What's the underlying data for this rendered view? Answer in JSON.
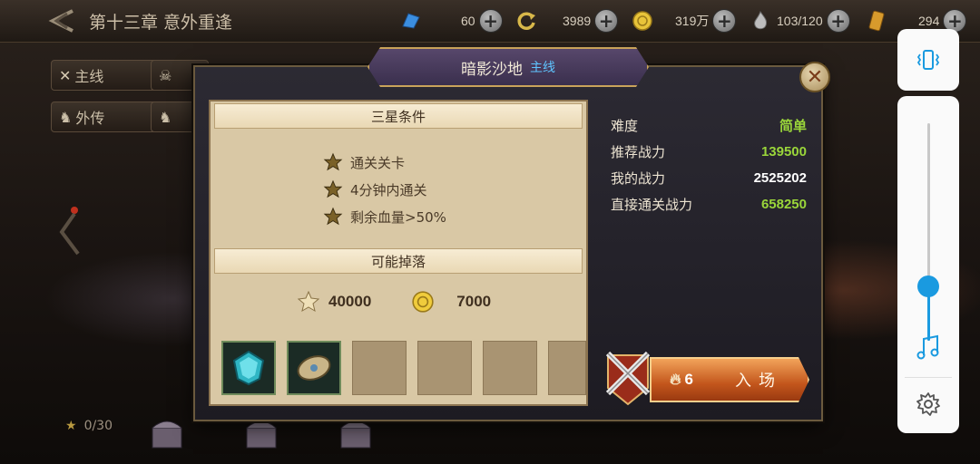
{
  "header": {
    "chapter_title": "第十三章 意外重逢",
    "resources": [
      {
        "name": "crystal",
        "value": "60",
        "icon": "crystal-icon",
        "color": "#3b8ee0"
      },
      {
        "name": "refresh",
        "value": "3989",
        "icon": "refresh-icon",
        "color": "#d8b84a"
      },
      {
        "name": "gold",
        "value": "319万",
        "icon": "gold-coin-icon",
        "color": "#e8c43a"
      },
      {
        "name": "stamina",
        "value": "103/120",
        "icon": "flame-icon",
        "color": "#bdbdbd"
      },
      {
        "name": "ticket",
        "value": "294",
        "icon": "ticket-icon",
        "color": "#d79a2c"
      }
    ]
  },
  "side_tabs": {
    "main_story": "主线",
    "side_story": "外传"
  },
  "footer": {
    "star_progress": "0/30"
  },
  "dialog": {
    "stage_name": "暗影沙地",
    "stage_type": "主线",
    "three_star_header": "三星条件",
    "conditions": [
      "通关关卡",
      "4分钟内通关",
      "剩余血量>50%"
    ],
    "drops_header": "可能掉落",
    "exp_reward": "40000",
    "gold_reward": "7000",
    "stats": [
      {
        "label": "难度",
        "value": "简单",
        "color": "#9ad63a"
      },
      {
        "label": "推荐战力",
        "value": "139500",
        "color": "#9ad63a"
      },
      {
        "label": "我的战力",
        "value": "2525202",
        "color": "#ffffff"
      },
      {
        "label": "直接通关战力",
        "value": "658250",
        "color": "#9ad63a"
      }
    ],
    "enter_cost": "6",
    "enter_label": "入场"
  },
  "volume_level": 0.25
}
